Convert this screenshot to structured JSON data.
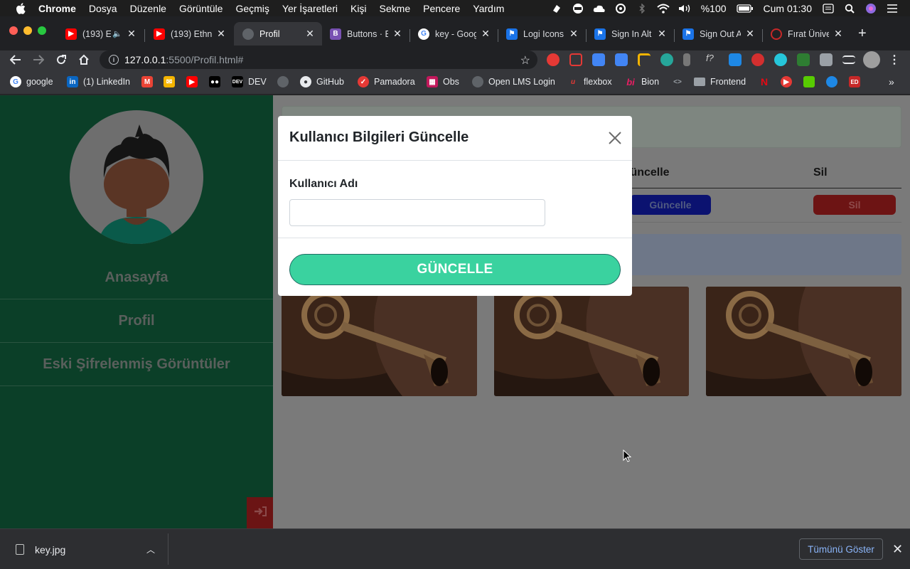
{
  "menubar": {
    "app": "Chrome",
    "items": [
      "Dosya",
      "Düzenle",
      "Görüntüle",
      "Geçmiş",
      "Yer İşaretleri",
      "Kişi",
      "Sekme",
      "Pencere",
      "Yardım"
    ],
    "battery": "%100",
    "clock": "Cum 01:30"
  },
  "tabs": [
    {
      "title": "(193) E",
      "icon": "youtube-icon",
      "color": "#ff0000"
    },
    {
      "title": "(193) Ethn",
      "icon": "youtube-icon",
      "color": "#ff0000"
    },
    {
      "title": "Profil",
      "icon": "globe-icon",
      "color": "#5f6368",
      "active": true
    },
    {
      "title": "Buttons · B",
      "icon": "bootstrap-icon",
      "color": "#7952b3"
    },
    {
      "title": "key - Goog",
      "icon": "google-icon",
      "color": "#ffffff"
    },
    {
      "title": "Logi Icons",
      "icon": "flag-icon",
      "color": "#1a73e8"
    },
    {
      "title": "Sign In Alt",
      "icon": "flag-icon",
      "color": "#1a73e8"
    },
    {
      "title": "Sign Out A",
      "icon": "flag-icon",
      "color": "#1a73e8"
    },
    {
      "title": "Fırat Ünive",
      "icon": "firat-icon",
      "color": "#c62828"
    }
  ],
  "address": {
    "host": "127.0.0.1",
    "rest": ":5500/Profil.html#"
  },
  "bookmarks": [
    {
      "label": "google",
      "icon": "google-icon"
    },
    {
      "label": "(1) LinkedIn",
      "icon": "linkedin-icon"
    },
    {
      "label": "",
      "icon": "gmail-icon"
    },
    {
      "label": "",
      "icon": "mail-icon"
    },
    {
      "label": "",
      "icon": "youtube-icon"
    },
    {
      "label": "",
      "icon": "medium-icon"
    },
    {
      "label": "DEV",
      "icon": "dev-icon"
    },
    {
      "label": "",
      "icon": "globe-icon"
    },
    {
      "label": "GitHub",
      "icon": "github-icon"
    },
    {
      "label": "Pamadora",
      "icon": "check-icon"
    },
    {
      "label": "Obs",
      "icon": "grid-icon"
    },
    {
      "label": "Open LMS Login",
      "icon": "globe-icon"
    },
    {
      "label": "flexbox",
      "icon": "flexbox-icon"
    },
    {
      "label": "Bion",
      "icon": "bi-icon"
    },
    {
      "label": "",
      "icon": "code-icon"
    },
    {
      "label": "Frontend",
      "icon": "folder-icon"
    }
  ],
  "sidebar": {
    "items": [
      {
        "label": "Anasayfa"
      },
      {
        "label": "Profil"
      },
      {
        "label": "Eski Şifrelenmiş Görüntüler"
      }
    ]
  },
  "table": {
    "headers": [
      "Güncelle",
      "Sil"
    ],
    "update_label": "Güncelle",
    "delete_label": "Sil"
  },
  "modal": {
    "title": "Kullanıcı Bilgileri Güncelle",
    "field_label": "Kullanıcı Adı",
    "field_value": "",
    "submit_label": "GÜNCELLE"
  },
  "downloads": {
    "file": "key.jpg",
    "show_all": "Tümünü Göster"
  },
  "colors": {
    "sidebar": "#0b3f28",
    "submit": "#3ad29f",
    "update": "#0b1270",
    "delete": "#6d1414"
  }
}
